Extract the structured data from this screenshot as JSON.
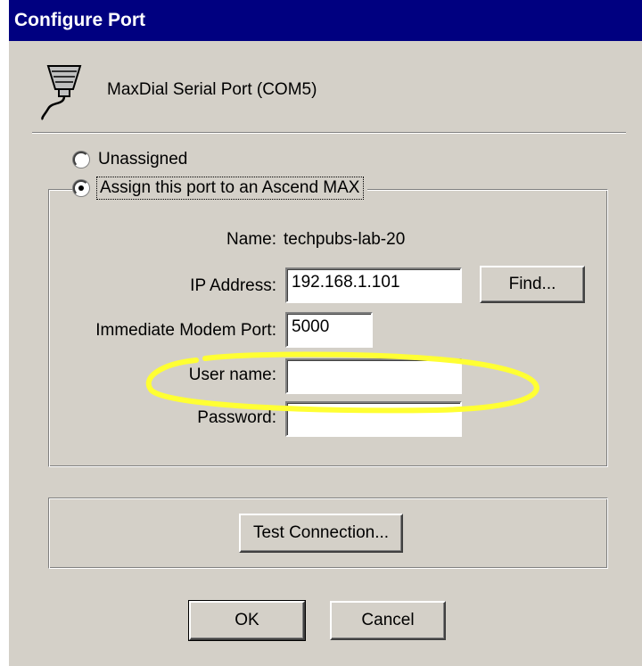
{
  "window": {
    "title": "Configure Port"
  },
  "port": {
    "label": "MaxDial Serial Port (COM5)",
    "icon": "serial-port-icon"
  },
  "options": {
    "unassigned_label": "Unassigned",
    "assign_label": "Assign this port to an Ascend MAX",
    "selected": "assign"
  },
  "form": {
    "name_label": "Name:",
    "name_value": "techpubs-lab-20",
    "ip_label": "IP Address:",
    "ip_value": "192.168.1.101",
    "modem_port_label": "Immediate Modem Port:",
    "modem_port_value": "5000",
    "username_label": "User name:",
    "username_value": "",
    "password_label": "Password:",
    "password_value": ""
  },
  "buttons": {
    "find": "Find...",
    "test_connection": "Test Connection...",
    "ok": "OK",
    "cancel": "Cancel"
  },
  "colors": {
    "titlebar": "#000080",
    "dialog_bg": "#d4d0c8",
    "highlight": "#ffff33"
  }
}
